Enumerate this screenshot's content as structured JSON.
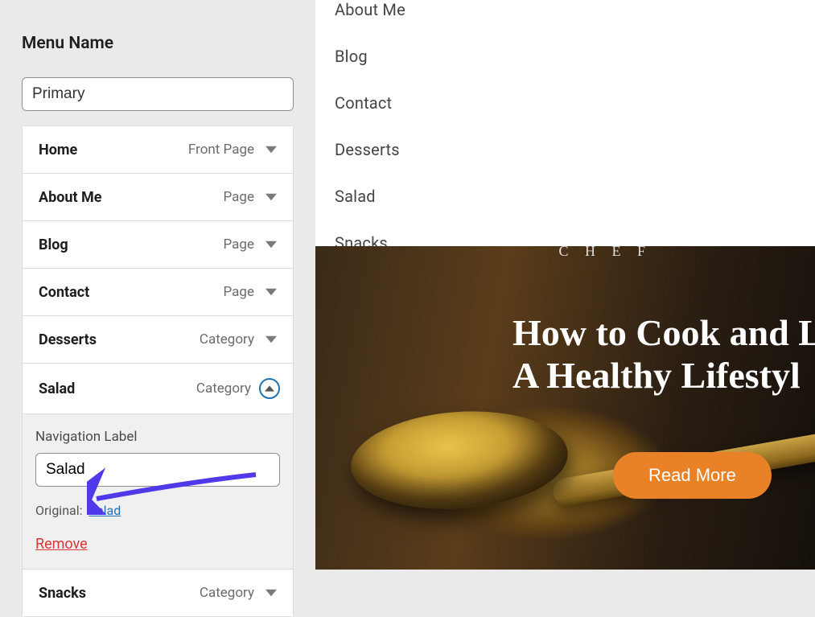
{
  "sidebar": {
    "section_title": "Menu Name",
    "menu_name_value": "Primary",
    "items": [
      {
        "label": "Home",
        "type": "Front Page",
        "expanded": false
      },
      {
        "label": "About Me",
        "type": "Page",
        "expanded": false
      },
      {
        "label": "Blog",
        "type": "Page",
        "expanded": false
      },
      {
        "label": "Contact",
        "type": "Page",
        "expanded": false
      },
      {
        "label": "Desserts",
        "type": "Category",
        "expanded": false
      },
      {
        "label": "Salad",
        "type": "Category",
        "expanded": true
      },
      {
        "label": "Snacks",
        "type": "Category",
        "expanded": false
      }
    ],
    "expanded_panel": {
      "field_label": "Navigation Label",
      "nav_label_value": "Salad",
      "original_prefix": "Original:",
      "original_link": "Salad",
      "remove_label": "Remove"
    }
  },
  "preview": {
    "nav": [
      "About Me",
      "Blog",
      "Contact",
      "Desserts",
      "Salad",
      "Snacks"
    ],
    "hero": {
      "badge_text": "C H E F",
      "title_line1": "How to Cook and L",
      "title_line2": "A Healthy Lifestyl",
      "cta_label": "Read More"
    }
  },
  "colors": {
    "accent_link": "#2271b1",
    "danger": "#d63638",
    "hero_cta": "#e98127"
  }
}
